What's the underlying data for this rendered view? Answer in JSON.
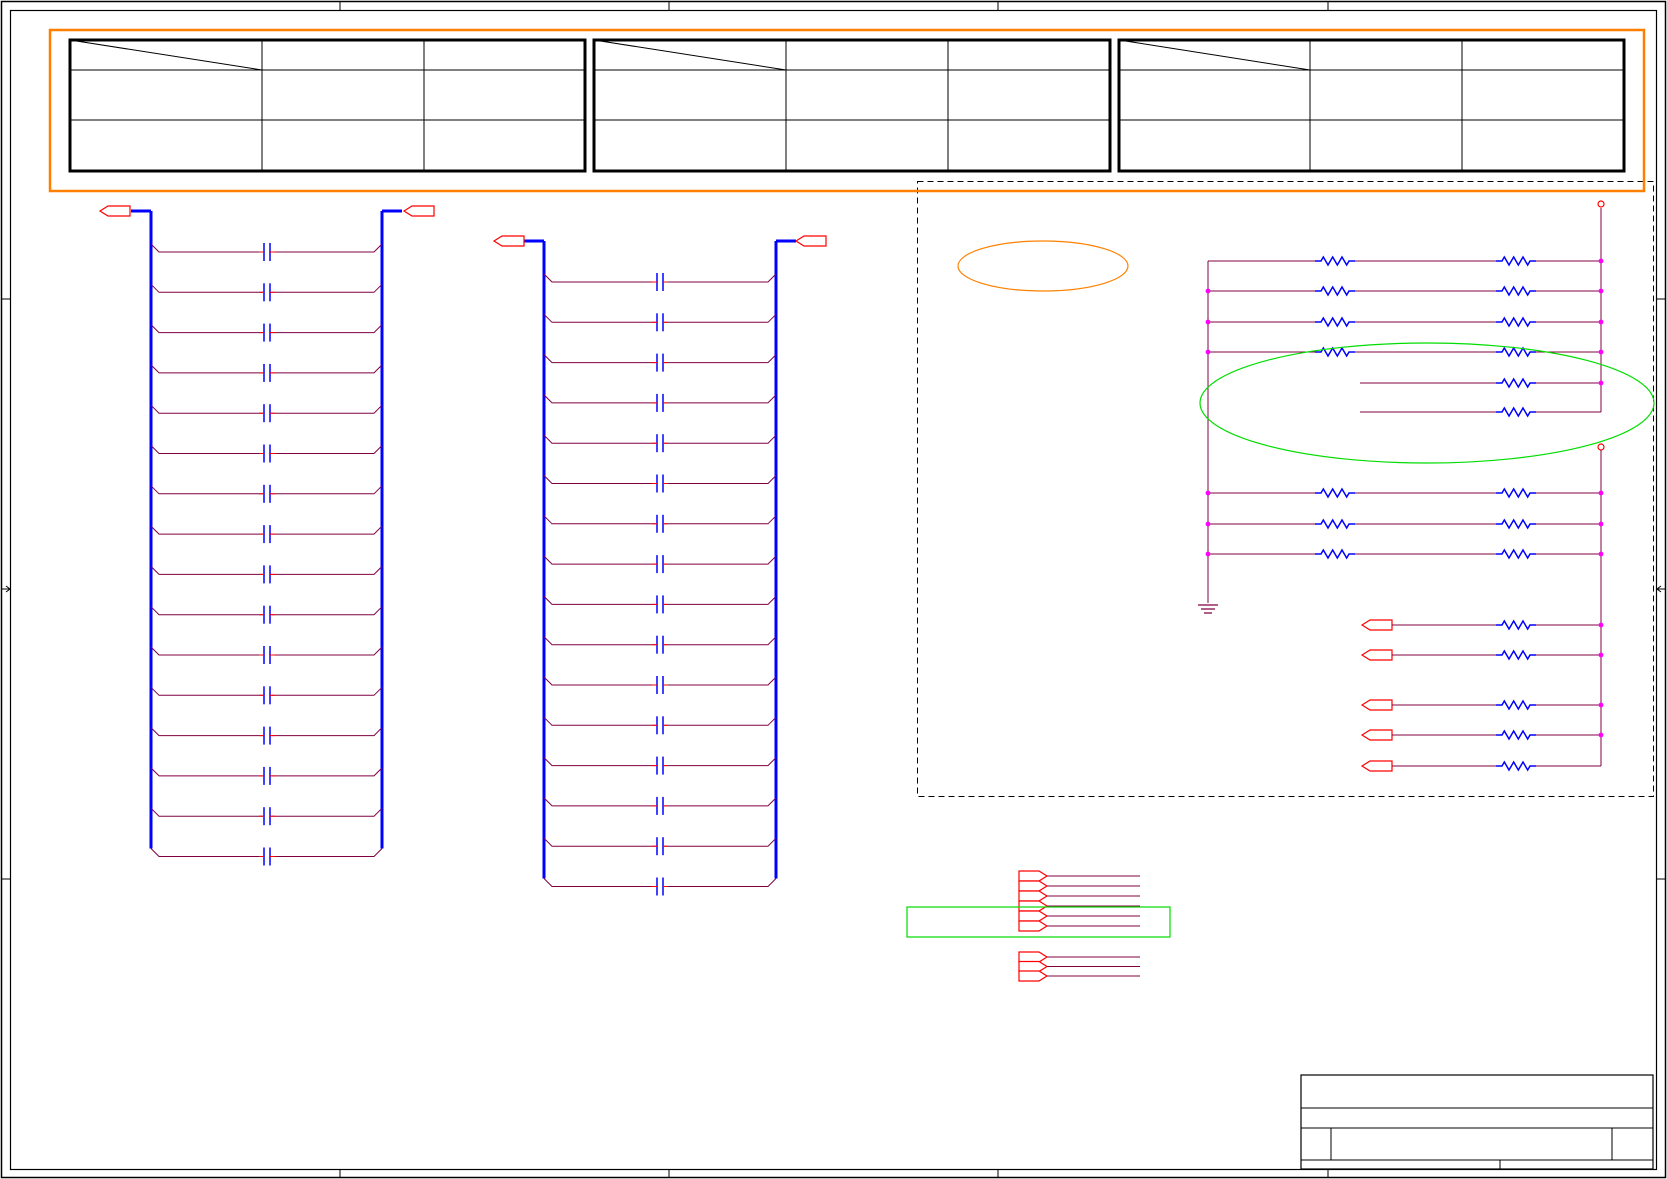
{
  "colors": {
    "border": "#000000",
    "highlight_orange": "#ff8000",
    "highlight_green": "#00dd00",
    "bus_blue": "#0000ff",
    "wire": "#800040",
    "port_red": "#ff0000",
    "junction_magenta": "#ff00ff",
    "component_blue": "#0000ff",
    "dashed_frame": "#000000"
  },
  "tables": [
    {
      "rows": 3,
      "cols": 3,
      "cells": []
    },
    {
      "rows": 3,
      "cols": 3,
      "cells": []
    },
    {
      "rows": 3,
      "cols": 3,
      "cells": []
    }
  ],
  "cap_bank_left": {
    "capacitor_count": 16,
    "ports": [
      "",
      ""
    ]
  },
  "cap_bank_mid": {
    "capacitor_count": 16,
    "ports": [
      "",
      ""
    ]
  },
  "resistor_network": {
    "upper_pairs": 6,
    "lower_pairs": 3,
    "port_resistors": 5
  },
  "connector_group_upper": {
    "count": 6
  },
  "connector_group_lower": {
    "count": 3
  },
  "title_block": {
    "title": "",
    "sheet": "",
    "rev": ""
  },
  "icons": [
    "port-flag-icon",
    "capacitor-icon",
    "resistor-icon",
    "ground-icon",
    "junction-dot-icon",
    "power-terminal-icon"
  ]
}
